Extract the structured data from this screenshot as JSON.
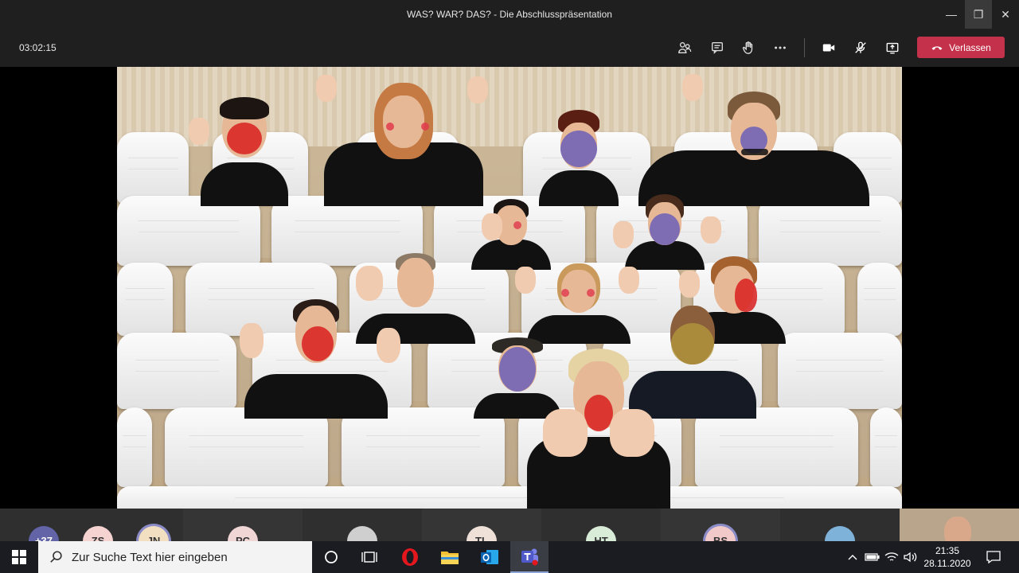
{
  "window": {
    "title": "WAS? WAR? DAS? - Die Abschlusspräsentation",
    "minimize": "—",
    "restore": "❐",
    "close": "✕"
  },
  "toolbar": {
    "timer": "03:02:15",
    "leave_label": "Verlassen",
    "icons": [
      "participants-icon",
      "chat-icon",
      "raise-hand-icon",
      "more-options-icon",
      "camera-icon",
      "mic-muted-icon",
      "share-screen-icon",
      "phone-hangup-icon"
    ],
    "accent": "#c4314b"
  },
  "participant_strip": {
    "tiles": [
      {
        "initials": "+37",
        "color": "#6264a7"
      },
      {
        "initials": "ZS",
        "color": "#f4d3d0"
      },
      {
        "initials": "JN",
        "color": "#f2dfc2"
      },
      {
        "initials": "PC",
        "color": "#f1d6d6"
      },
      {
        "initials": "",
        "color": "#cfcfcf"
      },
      {
        "initials": "TL",
        "color": "#efe0d8"
      },
      {
        "initials": "HT",
        "color": "#d8ecd8"
      },
      {
        "initials": "BS",
        "color": "#f2c9c9"
      },
      {
        "initials": "",
        "color": "#7fb2d9"
      }
    ]
  },
  "taskbar": {
    "search_placeholder": "Zur Suche Text hier eingeben",
    "time": "21:35",
    "date": "28.11.2020"
  }
}
